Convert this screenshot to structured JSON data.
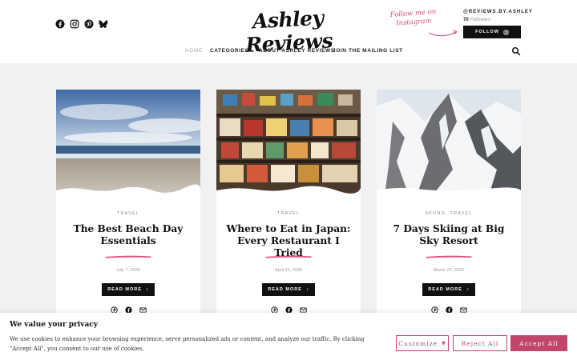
{
  "header": {
    "logo": "Ashley Reviews",
    "social_icons": [
      "facebook-icon",
      "instagram-icon",
      "pinterest-icon",
      "bluesky-icon"
    ],
    "follow_script_line1": "Follow me on",
    "follow_script_line2": "Instagram",
    "instagram_handle": "@REVIEWS.BY.ASHLEY",
    "follower_count": "70",
    "follower_label": "Followers",
    "follow_button": "FOLLOW"
  },
  "nav": {
    "home": "HOME",
    "categories": "CATEGORIES",
    "about": "ABOUT ASHLEY REVIEWS",
    "mailing": "JOIN THE MAILING LIST"
  },
  "cards": [
    {
      "category": "TRAVEL",
      "title": "The Best Beach Day Essentials",
      "date": "July 7, 2026",
      "button": "READ MORE"
    },
    {
      "category": "TRAVEL",
      "title": "Where to Eat in Japan: Every Restaurant I Tried",
      "date": "April 10, 2026",
      "button": "READ MORE"
    },
    {
      "category": "SKIING, TRAVEL",
      "title": "7 Days Skiing at Big Sky Resort",
      "date": "March 27, 2026",
      "button": "READ MORE"
    }
  ],
  "cookie": {
    "title": "We value your privacy",
    "text": "We use cookies to enhance your browsing experience, serve personalized ads or content, and analyze our traffic. By clicking \"Accept All\", you consent to our use of cookies.",
    "customize": "Customize",
    "reject": "Reject All",
    "accept": "Accept All"
  },
  "colors": {
    "accent_pink": "#c2456a",
    "swash_pink": "#e0507d",
    "background": "#f1f1f2"
  }
}
